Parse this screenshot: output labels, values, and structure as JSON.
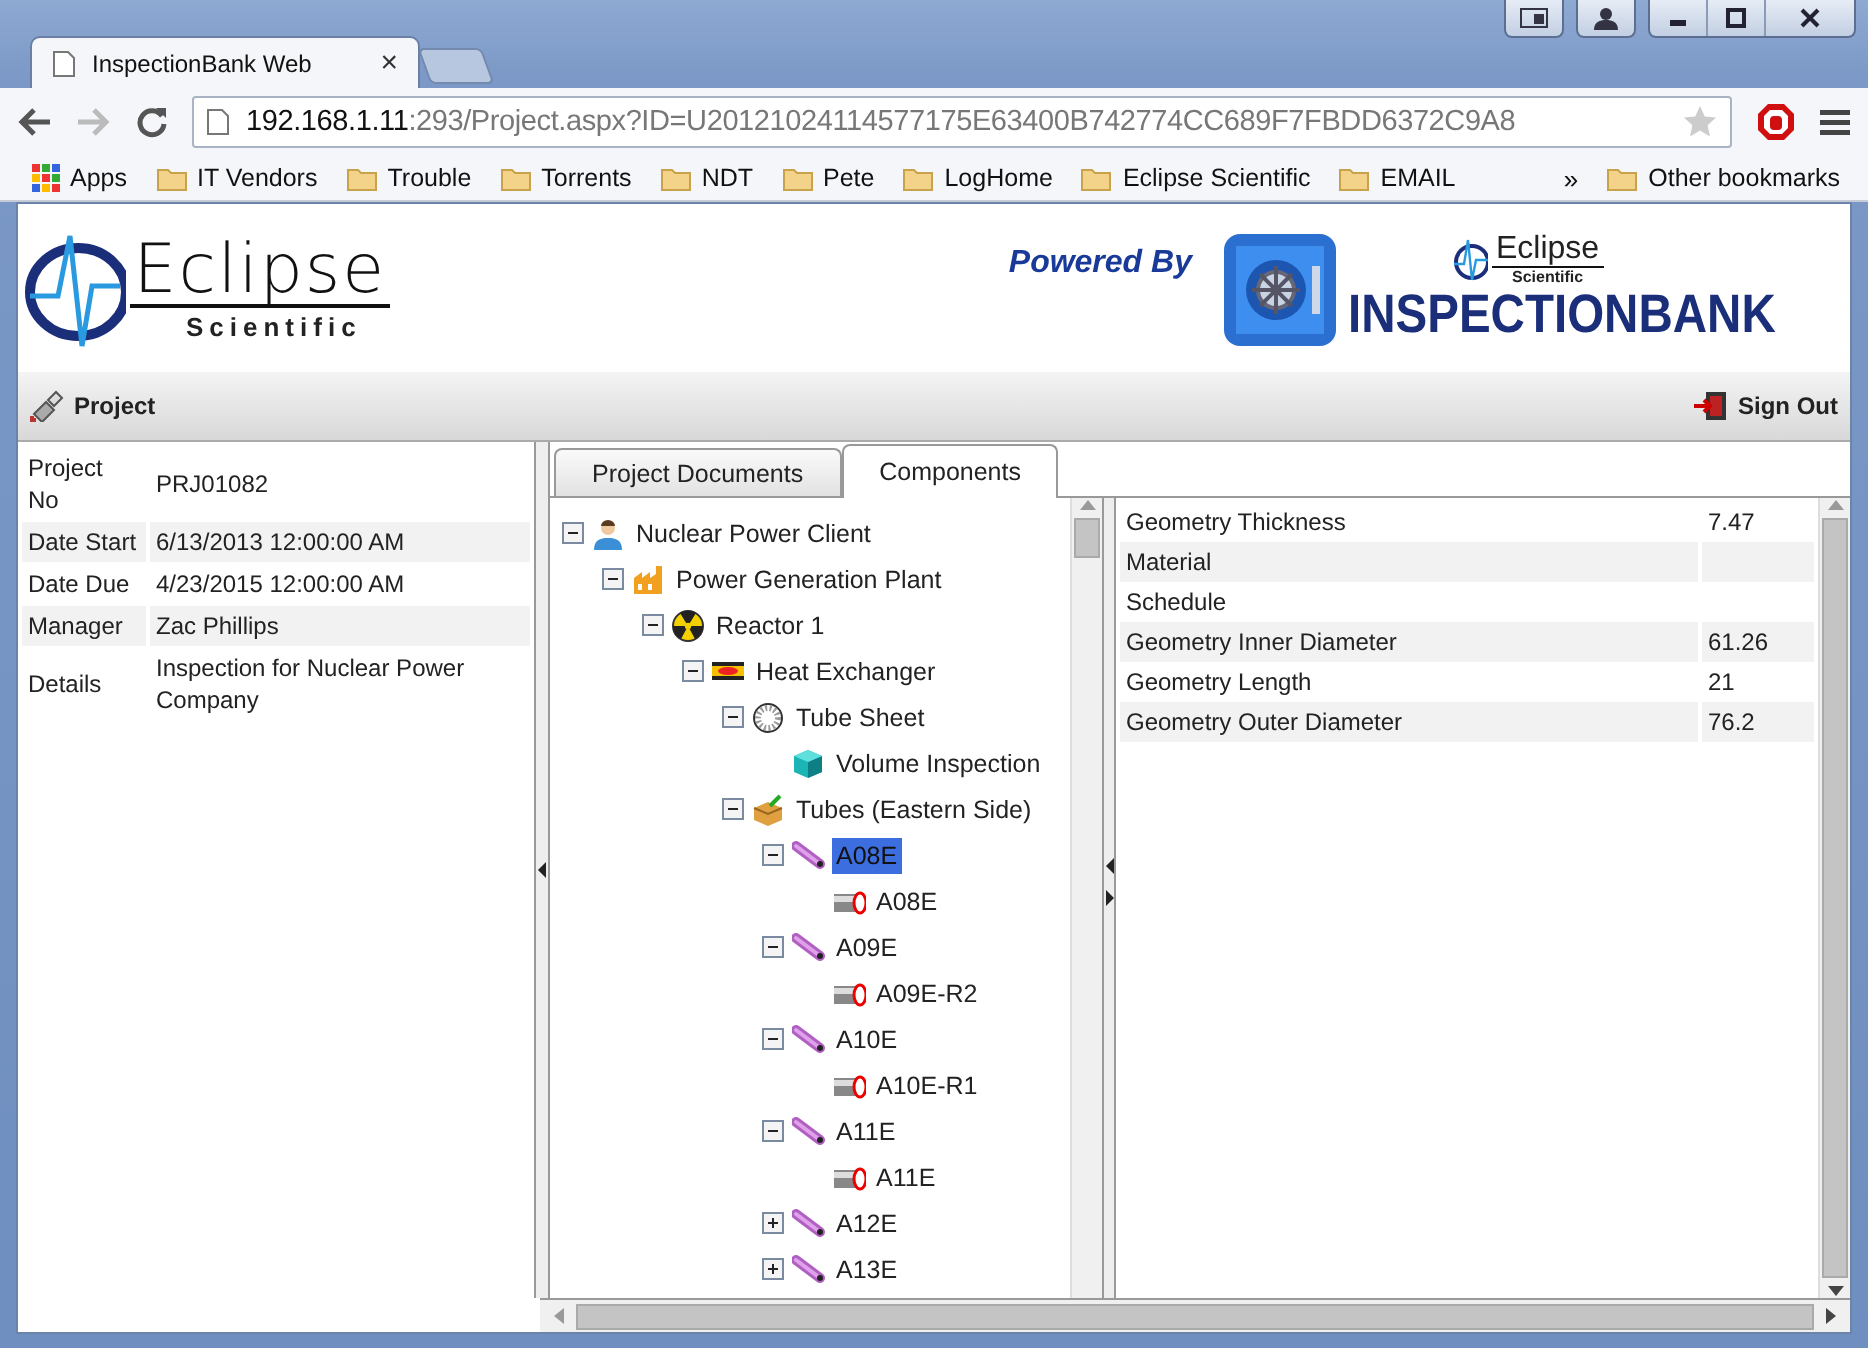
{
  "browser": {
    "tab_title": "InspectionBank Web",
    "tab_close": "×",
    "host": "192.168.1.11",
    "path": ":293/Project.aspx?ID=U20121024114577175E63400B742774CC689F7FBDD6372C9A8"
  },
  "bookmarks": [
    {
      "label": "Apps",
      "kind": "apps"
    },
    {
      "label": "IT Vendors",
      "kind": "folder"
    },
    {
      "label": "Trouble",
      "kind": "folder"
    },
    {
      "label": "Torrents",
      "kind": "folder"
    },
    {
      "label": "NDT",
      "kind": "folder"
    },
    {
      "label": "Pete",
      "kind": "folder"
    },
    {
      "label": "LogHome",
      "kind": "folder"
    },
    {
      "label": "Eclipse Scientific",
      "kind": "folder"
    },
    {
      "label": "EMAIL",
      "kind": "folder"
    }
  ],
  "bookmarks_overflow": "»",
  "other_bookmarks": "Other bookmarks",
  "header": {
    "logo_name": "Eclipse",
    "logo_sub": "Scientific",
    "powered_by": "Powered By",
    "brand_name": "Eclipse",
    "brand_sub": "Scientific",
    "brand": "INSPECTIONBANK"
  },
  "toolbar": {
    "project": "Project",
    "sign_out": "Sign Out"
  },
  "details": [
    {
      "label": "Project No",
      "value": "PRJ01082"
    },
    {
      "label": "Date Start",
      "value": "6/13/2013 12:00:00 AM"
    },
    {
      "label": "Date Due",
      "value": "4/23/2015 12:00:00 AM"
    },
    {
      "label": "Manager",
      "value": "Zac Phillips"
    },
    {
      "label": "Details",
      "value": "Inspection for Nuclear Power Company"
    }
  ],
  "tabs": [
    {
      "label": "Project Documents",
      "selected": false
    },
    {
      "label": "Components",
      "selected": true
    }
  ],
  "tree": [
    {
      "label": "Nuclear Power Client",
      "kind": "person",
      "expanded": true,
      "selected": false,
      "children": [
        {
          "label": "Power Generation Plant",
          "kind": "factory",
          "expanded": true,
          "selected": false,
          "children": [
            {
              "label": "Reactor 1",
              "kind": "radiation",
              "expanded": true,
              "selected": false,
              "children": [
                {
                  "label": "Heat Exchanger",
                  "kind": "exchanger",
                  "expanded": true,
                  "selected": false,
                  "children": [
                    {
                      "label": "Tube Sheet",
                      "kind": "sheet",
                      "expanded": true,
                      "selected": false,
                      "children": [
                        {
                          "label": "Volume Inspection",
                          "kind": "cube",
                          "selected": false
                        }
                      ]
                    },
                    {
                      "label": "Tubes (Eastern Side)",
                      "kind": "box",
                      "expanded": true,
                      "selected": false,
                      "children": [
                        {
                          "label": "A08E",
                          "kind": "tube",
                          "expanded": true,
                          "selected": true,
                          "children": [
                            {
                              "label": "A08E",
                              "kind": "pipe",
                              "selected": false
                            }
                          ]
                        },
                        {
                          "label": "A09E",
                          "kind": "tube",
                          "expanded": true,
                          "selected": false,
                          "children": [
                            {
                              "label": "A09E-R2",
                              "kind": "pipe",
                              "selected": false
                            }
                          ]
                        },
                        {
                          "label": "A10E",
                          "kind": "tube",
                          "expanded": true,
                          "selected": false,
                          "children": [
                            {
                              "label": "A10E-R1",
                              "kind": "pipe",
                              "selected": false
                            }
                          ]
                        },
                        {
                          "label": "A11E",
                          "kind": "tube",
                          "expanded": true,
                          "selected": false,
                          "children": [
                            {
                              "label": "A11E",
                              "kind": "pipe",
                              "selected": false
                            }
                          ]
                        },
                        {
                          "label": "A12E",
                          "kind": "tube",
                          "expanded": false,
                          "selected": false
                        },
                        {
                          "label": "A13E",
                          "kind": "tube",
                          "expanded": false,
                          "selected": false
                        }
                      ]
                    }
                  ]
                }
              ]
            }
          ]
        }
      ]
    }
  ],
  "properties": [
    {
      "name": "Geometry Thickness",
      "value": "7.47"
    },
    {
      "name": "Material"
    },
    {
      "name": "Schedule"
    },
    {
      "name": "Geometry Inner Diameter",
      "value": "61.26"
    },
    {
      "name": "Geometry Length",
      "value": "21"
    },
    {
      "name": "Geometry Outer Diameter",
      "value": "76.2"
    }
  ]
}
